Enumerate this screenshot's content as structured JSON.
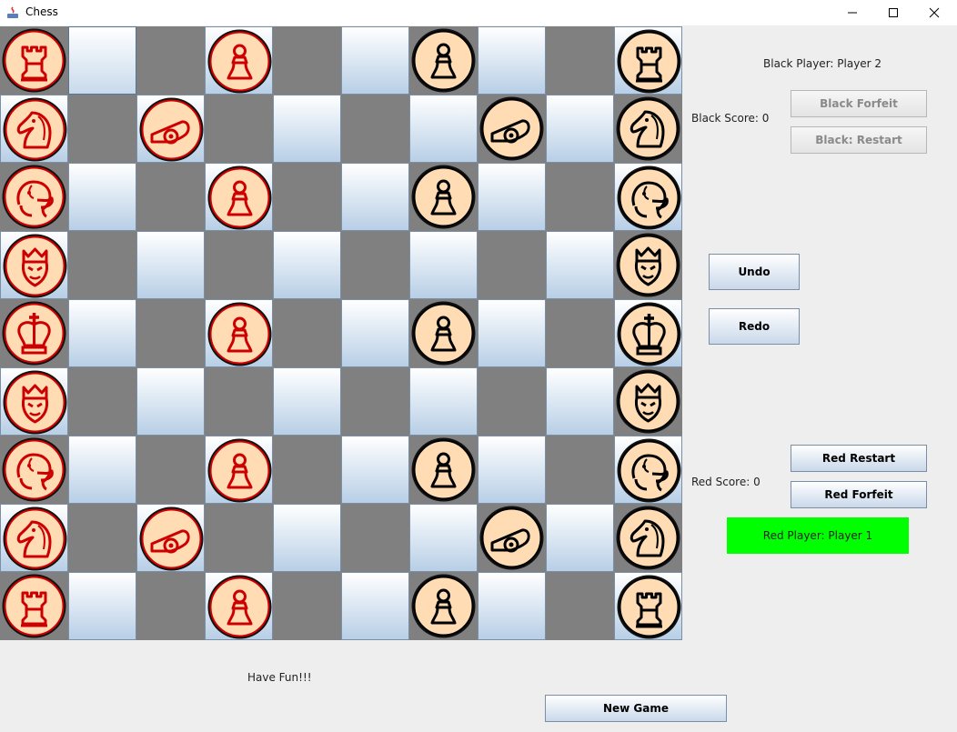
{
  "window": {
    "title": "Chess",
    "icons": [
      "java-app-icon",
      "minimize-icon",
      "maximize-icon",
      "close-icon"
    ]
  },
  "board": {
    "cols": 10,
    "rows": 9,
    "selected": [
      0,
      1
    ],
    "pieces": [
      {
        "row": 0,
        "col": 0,
        "color": "red",
        "type": "rook"
      },
      {
        "row": 0,
        "col": 3,
        "color": "red",
        "type": "pawn"
      },
      {
        "row": 0,
        "col": 6,
        "color": "black",
        "type": "pawn"
      },
      {
        "row": 0,
        "col": 9,
        "color": "black",
        "type": "rook"
      },
      {
        "row": 1,
        "col": 0,
        "color": "red",
        "type": "knight"
      },
      {
        "row": 1,
        "col": 2,
        "color": "red",
        "type": "cannon"
      },
      {
        "row": 1,
        "col": 7,
        "color": "black",
        "type": "cannon"
      },
      {
        "row": 1,
        "col": 9,
        "color": "black",
        "type": "knight"
      },
      {
        "row": 2,
        "col": 0,
        "color": "red",
        "type": "elephant"
      },
      {
        "row": 2,
        "col": 3,
        "color": "red",
        "type": "pawn"
      },
      {
        "row": 2,
        "col": 6,
        "color": "black",
        "type": "pawn"
      },
      {
        "row": 2,
        "col": 9,
        "color": "black",
        "type": "elephant"
      },
      {
        "row": 3,
        "col": 0,
        "color": "red",
        "type": "guard"
      },
      {
        "row": 3,
        "col": 9,
        "color": "black",
        "type": "guard"
      },
      {
        "row": 4,
        "col": 0,
        "color": "red",
        "type": "king"
      },
      {
        "row": 4,
        "col": 3,
        "color": "red",
        "type": "pawn"
      },
      {
        "row": 4,
        "col": 6,
        "color": "black",
        "type": "pawn"
      },
      {
        "row": 4,
        "col": 9,
        "color": "black",
        "type": "king"
      },
      {
        "row": 5,
        "col": 0,
        "color": "red",
        "type": "guard"
      },
      {
        "row": 5,
        "col": 9,
        "color": "black",
        "type": "guard"
      },
      {
        "row": 6,
        "col": 0,
        "color": "red",
        "type": "elephant"
      },
      {
        "row": 6,
        "col": 3,
        "color": "red",
        "type": "pawn"
      },
      {
        "row": 6,
        "col": 6,
        "color": "black",
        "type": "pawn"
      },
      {
        "row": 6,
        "col": 9,
        "color": "black",
        "type": "elephant"
      },
      {
        "row": 7,
        "col": 0,
        "color": "red",
        "type": "knight"
      },
      {
        "row": 7,
        "col": 2,
        "color": "red",
        "type": "cannon"
      },
      {
        "row": 7,
        "col": 7,
        "color": "black",
        "type": "cannon"
      },
      {
        "row": 7,
        "col": 9,
        "color": "black",
        "type": "knight"
      },
      {
        "row": 8,
        "col": 0,
        "color": "red",
        "type": "rook"
      },
      {
        "row": 8,
        "col": 3,
        "color": "red",
        "type": "pawn"
      },
      {
        "row": 8,
        "col": 6,
        "color": "black",
        "type": "pawn"
      },
      {
        "row": 8,
        "col": 9,
        "color": "black",
        "type": "rook"
      }
    ]
  },
  "colors": {
    "red_piece": "#cc0000",
    "black_piece": "#000000",
    "piece_fill": "#ffdcb4",
    "dark_square": "#808080",
    "active_player": "#00ff00"
  },
  "panel": {
    "black_player": "Black Player: Player 2",
    "black_score": "Black Score: 0",
    "black_forfeit": "Black Forfeit",
    "black_restart": "Black: Restart",
    "undo": "Undo",
    "redo": "Redo",
    "red_restart": "Red Restart",
    "red_score": "Red Score: 0",
    "red_forfeit": "Red Forfeit",
    "red_player": "Red Player: Player 1"
  },
  "footer": {
    "message": "Have Fun!!!",
    "new_game": "New Game"
  }
}
